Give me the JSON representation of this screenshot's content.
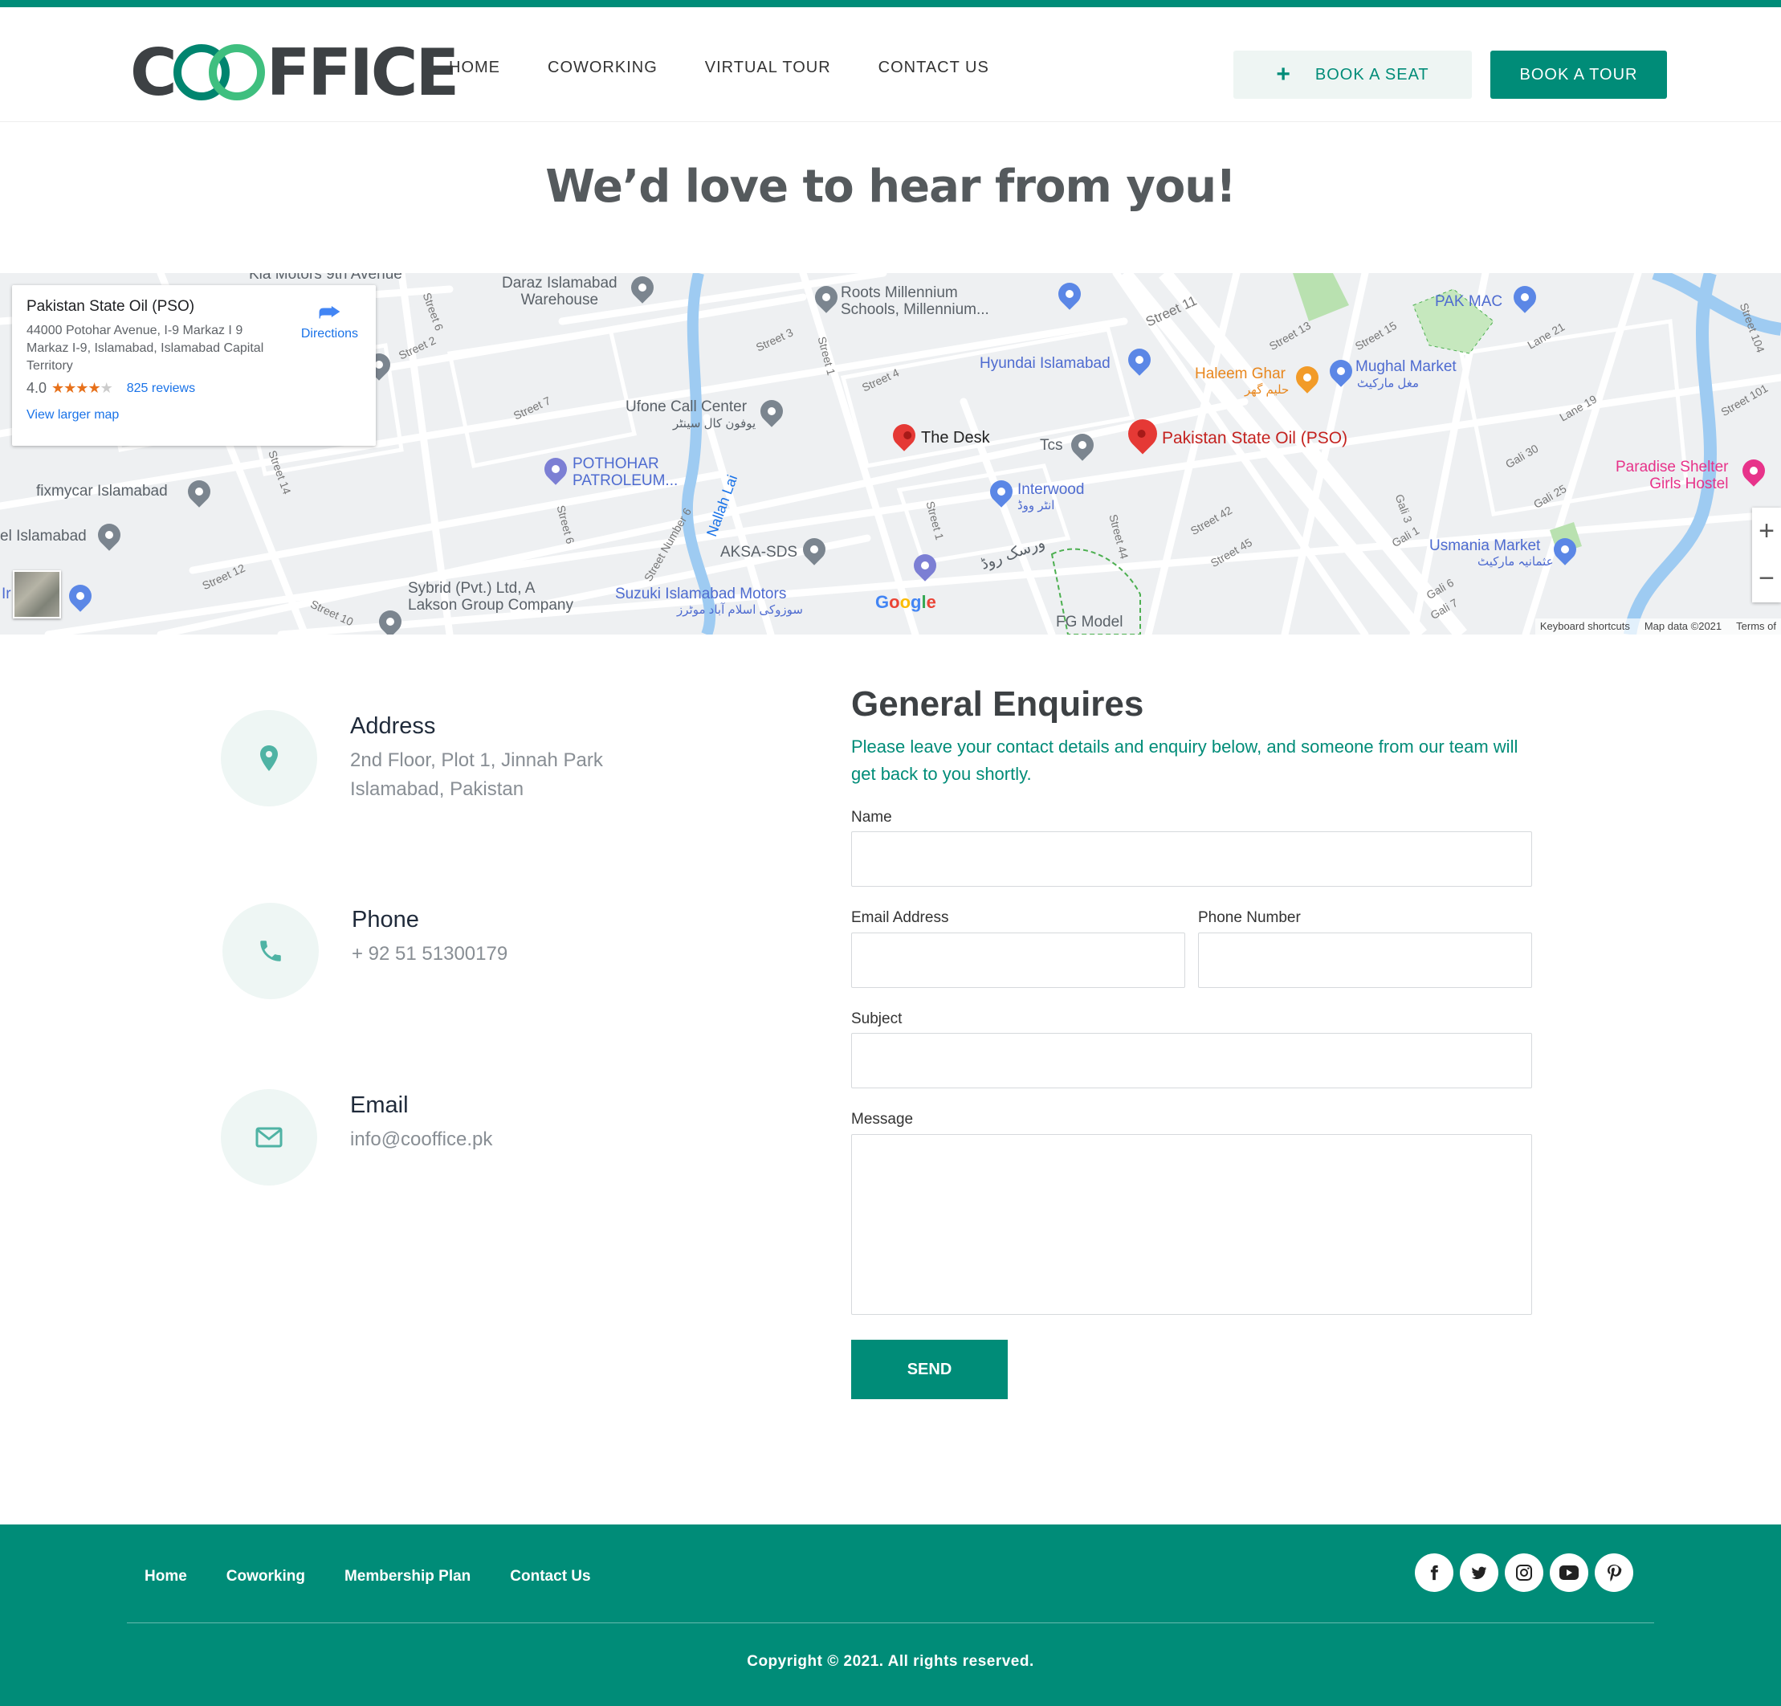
{
  "brand": {
    "logo_prefix": "C",
    "logo_suffix": "FFICE",
    "primary_color": "#008C78",
    "accent_color": "#3fbf7f"
  },
  "header": {
    "nav": [
      "HOME",
      "COWORKING",
      "VIRTUAL TOUR",
      "CONTACT US"
    ],
    "book_seat": "BOOK A SEAT",
    "book_tour": "BOOK A TOUR"
  },
  "hero": {
    "title": "We’d love to hear from you!"
  },
  "map": {
    "card": {
      "place": "Pakistan State Oil (PSO)",
      "address": "44000 Potohar Avenue, I-9 Markaz I 9 Markaz I-9, Islamabad, Islamabad Capital Territory",
      "rating": "4.0",
      "reviews": "825 reviews",
      "larger_map": "View larger map",
      "directions": "Directions"
    },
    "labels": {
      "kia": "Kia Motors 9th Avenue",
      "daraz": "Daraz Islamabad\nWarehouse",
      "roots": "Roots Millennium\nSchools, Millennium...",
      "hyundai": "Hyundai Islamabad",
      "haleem": "Haleem Ghar",
      "haleem_ur": "حلیم گھر",
      "mughal": "Mughal Market",
      "mughal_ur": "مغل مارکیٹ",
      "pakmac": "PAK MAC",
      "ufone": "Ufone Call Center",
      "ufone_ur": "یوفون کال سینٹر",
      "desk": "The Desk",
      "tcs": "Tcs",
      "pso": "Pakistan State Oil (PSO)",
      "paradise": "Paradise Shelter\nGirls Hostel",
      "pothohar": "POTHOHAR\nPATROLEUM...",
      "fixmycar": "fixmycar Islamabad",
      "islamabad": "el Islamabad",
      "interwood": "Interwood",
      "interwood_ur": "انٹر ووڈ",
      "aksa": "AKSA-SDS",
      "usmania": "Usmania Market",
      "usmania_ur": "عثمانیہ مارکیٹ",
      "sybrid": "Sybrid (Pvt.) Ltd, A\nLakson Group Company",
      "suzuki": "Suzuki Islamabad Motors",
      "suzuki_ur": "سوزوکی اسلام آباد موٹرز",
      "fgmodel": "FG Model",
      "nallah": "Nallah Lai",
      "warsak": "ورسک روڈ",
      "ir": "Ir"
    },
    "streets": [
      "Street 6",
      "Street 2",
      "Street 3",
      "Street 1",
      "Street 4",
      "Street 11",
      "Street 13",
      "Street 15",
      "Lane 21",
      "Street 104",
      "Street 101",
      "Street 7",
      "Street 14",
      "Street 12",
      "Street 10",
      "Street 6",
      "Street Number 6",
      "Street 1",
      "Street 44",
      "Street 42",
      "Street 45",
      "Lane 19",
      "Gali 30",
      "Gali 25",
      "Gali 3",
      "Gali 1",
      "Gali 6",
      "Gali 7"
    ],
    "google": "Google",
    "footer": [
      "Keyboard shortcuts",
      "Map data ©2021",
      "Terms of"
    ],
    "zoom_in": "+",
    "zoom_out": "−"
  },
  "contact": {
    "address_title": "Address",
    "address_line1": "2nd Floor, Plot 1, Jinnah Park",
    "address_line2": "Islamabad, Pakistan",
    "phone_title": "Phone",
    "phone": "+ 92 51 51300179",
    "email_title": "Email",
    "email": "info@cooffice.pk"
  },
  "form": {
    "title": "General Enquires",
    "subtitle": "Please leave your contact details and enquiry below, and someone from our team will get back to you shortly.",
    "name_label": "Name",
    "email_label": "Email Address",
    "phone_label": "Phone Number",
    "subject_label": "Subject",
    "message_label": "Message",
    "send": "SEND"
  },
  "footer": {
    "nav": [
      "Home",
      "Coworking",
      "Membership Plan",
      "Contact Us"
    ],
    "social_icons": [
      "facebook-icon",
      "twitter-icon",
      "instagram-icon",
      "youtube-icon",
      "pinterest-icon"
    ],
    "copyright": "Copyright © 2021. All rights reserved."
  }
}
